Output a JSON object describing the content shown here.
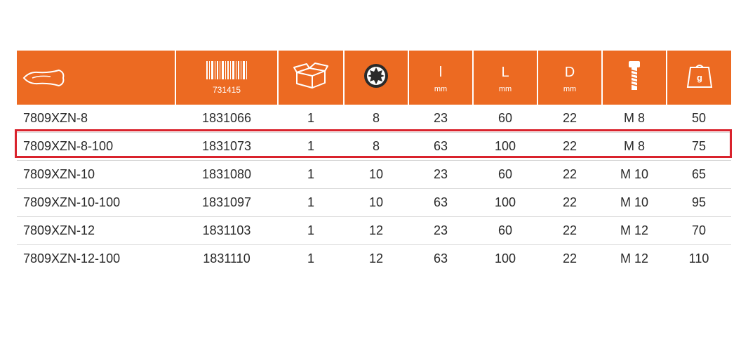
{
  "header": {
    "icons": [
      "product-icon",
      "barcode-icon",
      "package-icon",
      "socket-icon",
      "length-l-icon",
      "length-L-icon",
      "diameter-icon",
      "screw-icon",
      "weight-icon"
    ],
    "barcode_number": "731415",
    "l_letter": "l",
    "L_letter": "L",
    "D_letter": "D",
    "unit": "mm",
    "weight_label": "g",
    "accent_color": "#ec6a22"
  },
  "rows": [
    {
      "code": "7809XZN-8",
      "ean": "1831066",
      "qty": "1",
      "size": "8",
      "l": "23",
      "L": "60",
      "D": "22",
      "thread": "M 8",
      "weight": "50"
    },
    {
      "code": "7809XZN-8-100",
      "ean": "1831073",
      "qty": "1",
      "size": "8",
      "l": "63",
      "L": "100",
      "D": "22",
      "thread": "M 8",
      "weight": "75"
    },
    {
      "code": "7809XZN-10",
      "ean": "1831080",
      "qty": "1",
      "size": "10",
      "l": "23",
      "L": "60",
      "D": "22",
      "thread": "M 10",
      "weight": "65"
    },
    {
      "code": "7809XZN-10-100",
      "ean": "1831097",
      "qty": "1",
      "size": "10",
      "l": "63",
      "L": "100",
      "D": "22",
      "thread": "M 10",
      "weight": "95"
    },
    {
      "code": "7809XZN-12",
      "ean": "1831103",
      "qty": "1",
      "size": "12",
      "l": "23",
      "L": "60",
      "D": "22",
      "thread": "M 12",
      "weight": "70"
    },
    {
      "code": "7809XZN-12-100",
      "ean": "1831110",
      "qty": "1",
      "size": "12",
      "l": "63",
      "L": "100",
      "D": "22",
      "thread": "M 12",
      "weight": "110"
    }
  ],
  "highlight_color": "#d9232d"
}
